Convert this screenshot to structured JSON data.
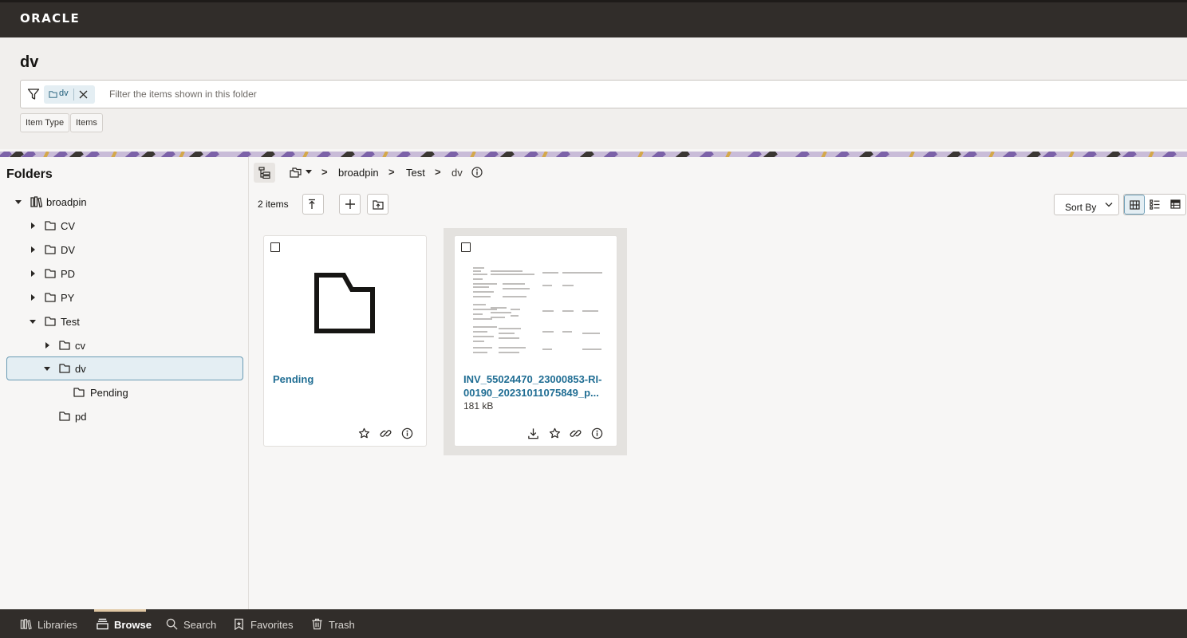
{
  "brand": {
    "logo": "ORACLE"
  },
  "page": {
    "title": "dv"
  },
  "filter": {
    "chip_label": "dv",
    "placeholder": "Filter the items shown in this folder",
    "facets": [
      "Item Type",
      "Items"
    ]
  },
  "sidebar": {
    "title": "Folders",
    "tree": [
      {
        "label": "broadpin",
        "icon": "library-icon",
        "expanded": true
      },
      {
        "label": "CV",
        "icon": "folder-icon",
        "expanded": false
      },
      {
        "label": "DV",
        "icon": "folder-icon",
        "expanded": false
      },
      {
        "label": "PD",
        "icon": "folder-icon",
        "expanded": false
      },
      {
        "label": "PY",
        "icon": "folder-icon",
        "expanded": false
      },
      {
        "label": "Test",
        "icon": "folder-icon",
        "expanded": true
      },
      {
        "label": "cv",
        "icon": "folder-icon",
        "expanded": false
      },
      {
        "label": "dv",
        "icon": "folder-icon",
        "expanded": true,
        "selected": true
      },
      {
        "label": "Pending",
        "icon": "folder-icon"
      },
      {
        "label": "pd",
        "icon": "folder-icon"
      }
    ]
  },
  "breadcrumb": {
    "items": [
      "broadpin",
      "Test",
      "dv"
    ],
    "separator": ">"
  },
  "toolbar": {
    "count": "2 items",
    "sort_label": "Sort By"
  },
  "items": [
    {
      "name": "Pending",
      "type": "folder",
      "size": ""
    },
    {
      "name": "INV_55024470_23000853-RI-00190_20231011075849_p...",
      "type": "document",
      "size": "181 kB"
    }
  ],
  "bottom_nav": [
    {
      "label": "Libraries",
      "icon": "library-icon"
    },
    {
      "label": "Browse",
      "icon": "browse-icon",
      "active": true
    },
    {
      "label": "Search",
      "icon": "search-icon"
    },
    {
      "label": "Favorites",
      "icon": "bookmark-icon"
    },
    {
      "label": "Trash",
      "icon": "trash-icon"
    }
  ],
  "colors": {
    "topbar": "#312d2a",
    "link": "#1f6d93",
    "selected_bg": "#e4eef3",
    "selected_border": "#6a9bb4"
  }
}
